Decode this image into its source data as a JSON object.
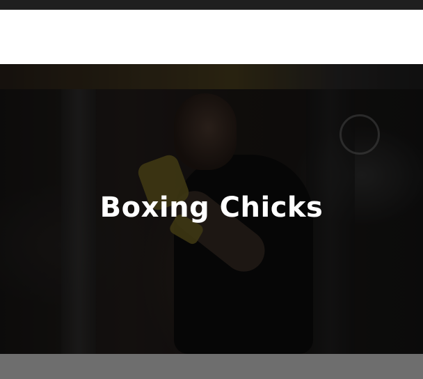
{
  "hero": {
    "title": "Boxing Chicks"
  },
  "colors": {
    "topbar": "#1f1f1f",
    "header": "#ffffff",
    "overlay": "rgba(0,0,0,0.55)",
    "footer": "#6e6e6e",
    "title_text": "#ffffff"
  }
}
